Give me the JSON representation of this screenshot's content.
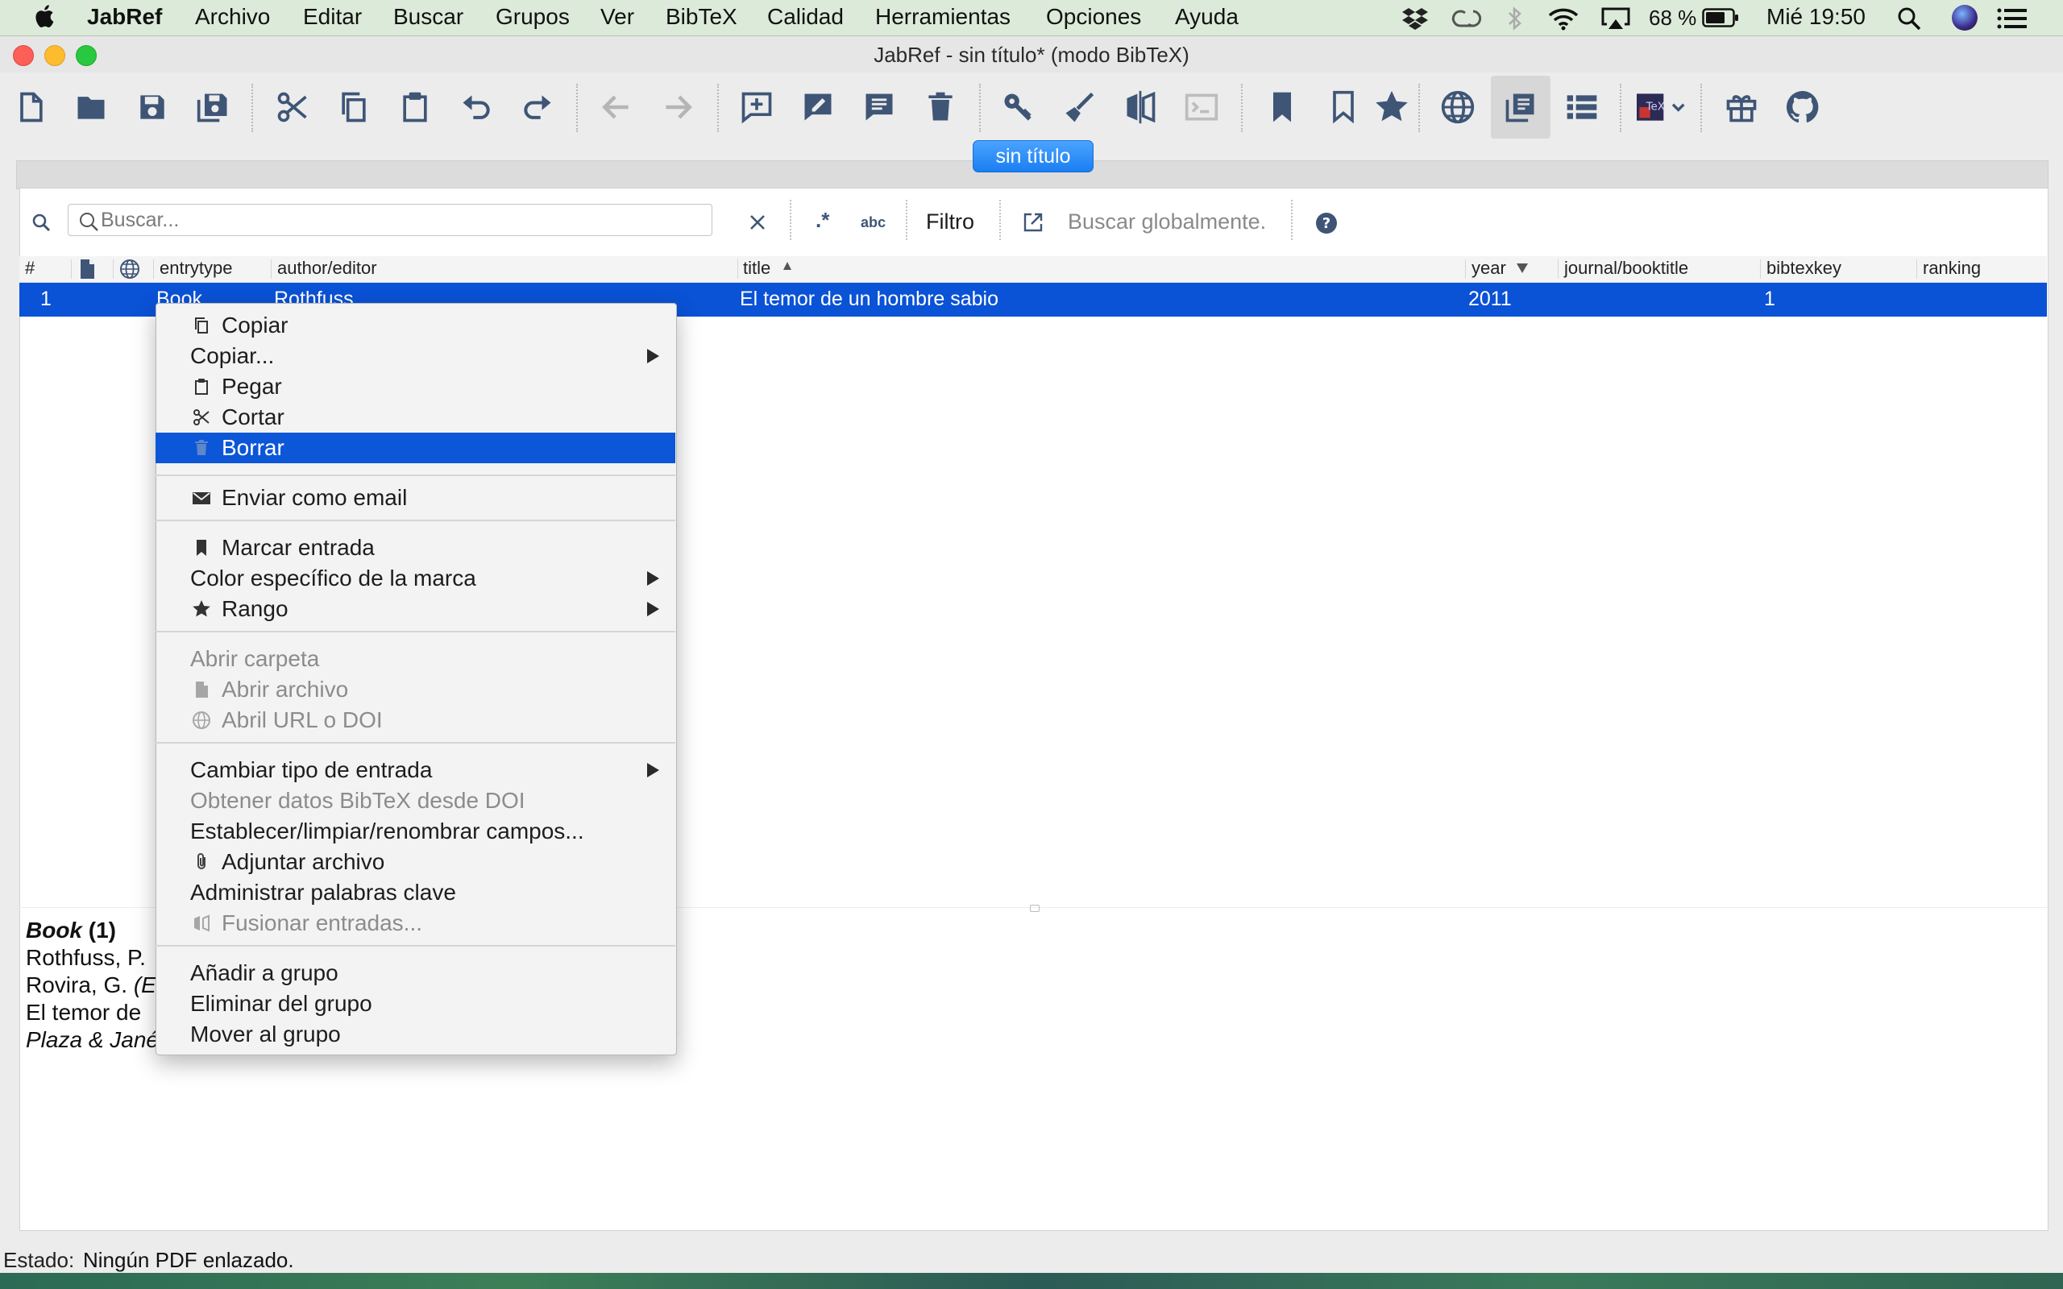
{
  "menubar": {
    "app": "JabRef",
    "items": [
      "Archivo",
      "Editar",
      "Buscar",
      "Grupos",
      "Ver",
      "BibTeX",
      "Calidad",
      "Herramientas",
      "Opciones",
      "Ayuda"
    ],
    "battery": "68 %",
    "clock": "Mié 19:50"
  },
  "window": {
    "title": "JabRef - sin título* (modo BibTeX)",
    "tab": "sin título"
  },
  "toolbar": {
    "icons": [
      "new-library",
      "open-library",
      "save",
      "save-all",
      "cut",
      "copy",
      "paste",
      "undo",
      "redo",
      "back",
      "forward",
      "new-entry",
      "new-entry-from-text",
      "add-comment",
      "delete-entry",
      "generate-key",
      "cleanup",
      "merge",
      "terminal",
      "mark",
      "unmark",
      "rank",
      "web-search",
      "show-entry-table",
      "group-view",
      "texstudio",
      "donate",
      "github"
    ]
  },
  "search": {
    "placeholder": "Buscar...",
    "filter_label": "Filtro",
    "global_label": "Buscar globalmente.",
    "regex_icon": ".*",
    "case_icon": "abc"
  },
  "table": {
    "columns": [
      "#",
      "entrytype",
      "author/editor",
      "title",
      "year",
      "journal/booktitle",
      "bibtexkey",
      "ranking"
    ],
    "rows": [
      {
        "num": "1",
        "entrytype": "Book",
        "author": "Rothfuss",
        "title": "El temor de un hombre sabio",
        "year": "2011",
        "bibtexkey": "1"
      }
    ]
  },
  "preview": {
    "type": "Book",
    "count": "(1)",
    "line1": "Rothfuss, P.",
    "line2_a": "Rovira, G.",
    "line2_b": "(E",
    "line3": "El temor de",
    "line4": "Plaza & Jané"
  },
  "status": {
    "label": "Estado:",
    "value": "Ningún PDF enlazado."
  },
  "context_menu": {
    "copy": "Copiar",
    "copy_submenu": "Copiar...",
    "paste": "Pegar",
    "cut": "Cortar",
    "delete": "Borrar",
    "send_email": "Enviar como email",
    "mark_entry": "Marcar entrada",
    "mark_color": "Color específico de la marca",
    "rank": "Rango",
    "open_folder": "Abrir carpeta",
    "open_file": "Abrir archivo",
    "open_url": "Abril URL o DOI",
    "change_type": "Cambiar tipo de entrada",
    "get_bibtex_doi": "Obtener datos BibTeX desde DOI",
    "set_fields": "Establecer/limpiar/renombrar campos...",
    "attach_file": "Adjuntar archivo",
    "manage_keywords": "Administrar palabras clave",
    "merge_entries": "Fusionar entradas...",
    "add_group": "Añadir a grupo",
    "remove_group": "Eliminar del grupo",
    "move_group": "Mover al grupo"
  },
  "colors": {
    "accent": "#0c56d8",
    "icon": "#3e5576",
    "menubar": "#dcebd9"
  }
}
